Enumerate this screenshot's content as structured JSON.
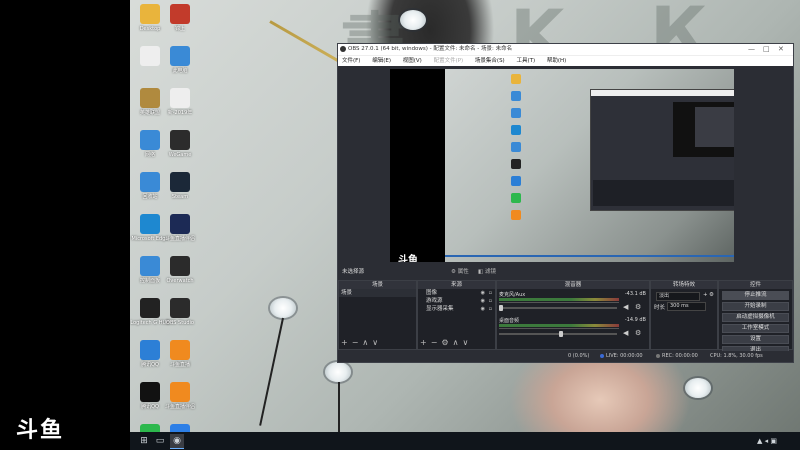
{
  "brand": {
    "logo_text": "斗鱼"
  },
  "desktop": {
    "icons": [
      {
        "label": "Desktop",
        "icon": "folder-icon",
        "color": "#e9b43c"
      },
      {
        "label": "锦上",
        "icon": "game-icon",
        "color": "#c23b2b"
      },
      {
        "label": "",
        "icon": "file-icon",
        "color": "#eeeeee"
      },
      {
        "label": "此电脑",
        "icon": "computer-icon",
        "color": "#3a8ad6"
      },
      {
        "label": "英雄联盟",
        "icon": "lol-icon",
        "color": "#b08a3e"
      },
      {
        "label": "新-2019年",
        "icon": "file-icon",
        "color": "#eeeeee"
      },
      {
        "label": "网络",
        "icon": "network-icon",
        "color": "#3a8ad6"
      },
      {
        "label": "WeGame",
        "icon": "wegame-icon",
        "color": "#2c2c2c"
      },
      {
        "label": "回收站",
        "icon": "recycle-icon",
        "color": "#3a8ad6"
      },
      {
        "label": "Steam",
        "icon": "steam-icon",
        "color": "#1b2838"
      },
      {
        "label": "Microsoft Edge",
        "icon": "edge-icon",
        "color": "#1e88d0"
      },
      {
        "label": "斗鱼直播伴侣",
        "icon": "douyu-icon",
        "color": "#1c2a55"
      },
      {
        "label": "控制面板",
        "icon": "control-icon",
        "color": "#3a8ad6"
      },
      {
        "label": "Overwatch",
        "icon": "overwatch-icon",
        "color": "#2b2b2b"
      },
      {
        "label": "Logitech G HUB",
        "icon": "logitech-icon",
        "color": "#222222"
      },
      {
        "label": "OBS Studio",
        "icon": "obs-icon",
        "color": "#2b2b2b"
      },
      {
        "label": "腾讯QQ",
        "icon": "qq-icon",
        "color": "#2c7fd6"
      },
      {
        "label": "斗鱼直播",
        "icon": "douyu-live-icon",
        "color": "#f08a1f"
      },
      {
        "label": "腾讯QQ",
        "icon": "qq-icon",
        "color": "#111111"
      },
      {
        "label": "斗鱼直播伴侣",
        "icon": "douyu-live-icon",
        "color": "#f08a1f"
      },
      {
        "label": "QQ音乐",
        "icon": "qqmusic-icon",
        "color": "#2db84d"
      },
      {
        "label": "飞书",
        "icon": "feishu-icon",
        "color": "#2d7fe6"
      }
    ]
  },
  "taskbar": {
    "time": "",
    "items": [
      "start-icon",
      "task-view-icon",
      "obs-taskbar-icon"
    ]
  },
  "obs": {
    "title": "OBS 27.0.1 (64 bit, windows) - 配置文件: 未命名 - 场景: 未命名",
    "menu": [
      "文件(F)",
      "编辑(E)",
      "视图(V)",
      "配置文件(P)",
      "场景集合(S)",
      "工具(T)",
      "帮助(H)"
    ],
    "scene_label": "未选择源",
    "props_btn": "属性",
    "filters_btn": "滤镜",
    "docks": {
      "scenes": {
        "title": "场景",
        "items": [
          "场景"
        ]
      },
      "sources": {
        "title": "来源",
        "items": [
          "图像",
          "游戏源",
          "显示器采集"
        ]
      },
      "mixer": {
        "title": "混音器",
        "tracks": [
          {
            "name": "麦克风/Aux",
            "db": "-43.1 dB",
            "level": 0.05
          },
          {
            "name": "桌面音频",
            "db": "-14.9 dB",
            "level": 0.55
          }
        ]
      },
      "transitions": {
        "title": "转场特效",
        "type": "淡出",
        "duration_label": "时长",
        "duration": "300 ms"
      },
      "controls": {
        "title": "控件",
        "buttons": [
          "停止推流",
          "开始录制",
          "启动虚拟摄像机",
          "工作室模式",
          "设置",
          "退出"
        ]
      }
    },
    "status": {
      "live": "LIVE: 00:00:00",
      "rec": "REC: 00:00:00",
      "cpu": "CPU: 1.8%, 30.00 fps",
      "dropped": "0 (0.0%)"
    }
  }
}
